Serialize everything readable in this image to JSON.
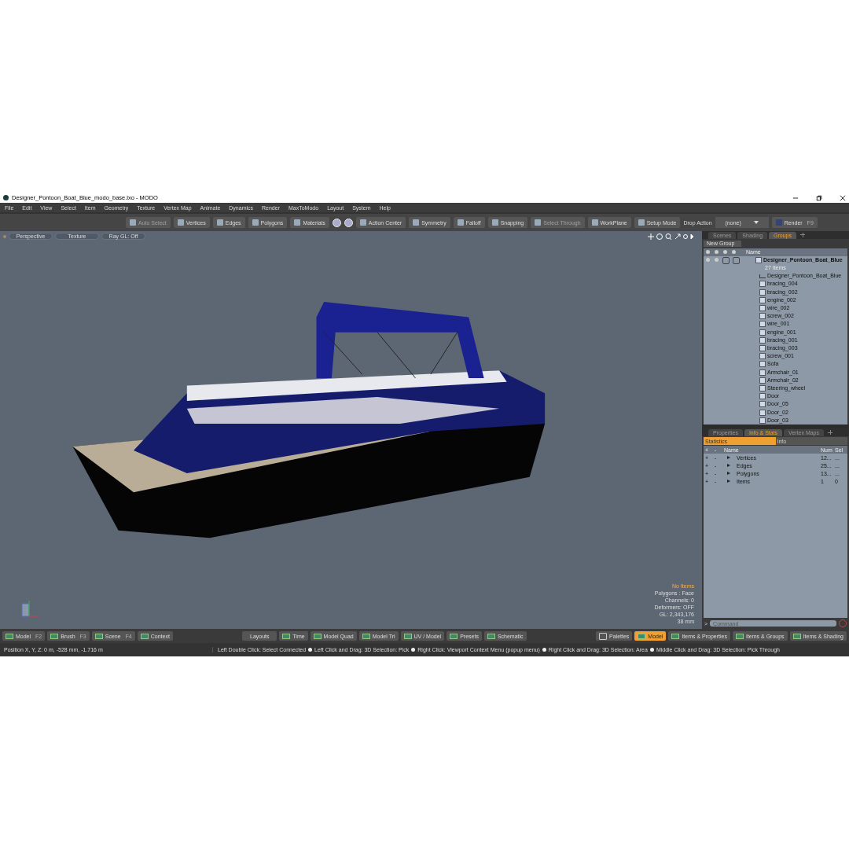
{
  "window": {
    "title": "Designer_Pontoon_Boat_Blue_modo_base.lxo - MODO"
  },
  "menu": [
    "File",
    "Edit",
    "View",
    "Select",
    "Item",
    "Geometry",
    "Texture",
    "Vertex Map",
    "Animate",
    "Dynamics",
    "Render",
    "MaxToModo",
    "Layout",
    "System",
    "Help"
  ],
  "toolbar": [
    {
      "label": "Auto Select",
      "disabled": true
    },
    {
      "label": "Vertices",
      "disabled": false
    },
    {
      "label": "Edges",
      "disabled": false
    },
    {
      "label": "Polygons",
      "disabled": false
    },
    {
      "label": "Materials",
      "disabled": false
    },
    {
      "label": "Action Center",
      "disabled": false
    },
    {
      "label": "Symmetry",
      "disabled": false
    },
    {
      "label": "Falloff",
      "disabled": false
    },
    {
      "label": "Snapping",
      "disabled": false
    },
    {
      "label": "Select Through",
      "disabled": true
    },
    {
      "label": "WorkPlane",
      "disabled": false
    },
    {
      "label": "Setup Mode",
      "disabled": false
    }
  ],
  "drop_action": {
    "label": "Drop Action",
    "value": "(none)"
  },
  "render": {
    "label": "Render",
    "shortcut": "F9"
  },
  "viewport": {
    "tabs": [
      "Perspective",
      "Texture",
      "Ray GL: Off"
    ],
    "info": [
      {
        "text": "No Items",
        "highlight": true
      },
      {
        "text": "Polygons : Face",
        "highlight": false
      },
      {
        "text": "Channels: 0",
        "highlight": false
      },
      {
        "text": "Deformers: OFF",
        "highlight": false
      },
      {
        "text": "GL: 2,343,176",
        "highlight": false
      },
      {
        "text": "38 mm",
        "highlight": false
      }
    ]
  },
  "groups_panel": {
    "tabs": [
      {
        "label": "Scenes",
        "selected": false
      },
      {
        "label": "Shading",
        "selected": false
      },
      {
        "label": "Groups",
        "selected": true
      }
    ],
    "new_group": "New Group",
    "column": "Name",
    "root": {
      "name": "Designer_Pontoon_Boat_Blue",
      "count": "27 Items",
      "toggles": [
        {
          "checked": false
        },
        {
          "checked": false
        }
      ]
    },
    "items": [
      {
        "name": "Designer_Pontoon_Boat_Blue",
        "kind": "locator"
      },
      {
        "name": "bracing_004",
        "kind": "mesh"
      },
      {
        "name": "bracing_002",
        "kind": "mesh"
      },
      {
        "name": "engine_002",
        "kind": "mesh"
      },
      {
        "name": "wire_002",
        "kind": "mesh"
      },
      {
        "name": "screw_002",
        "kind": "mesh"
      },
      {
        "name": "wire_001",
        "kind": "mesh"
      },
      {
        "name": "engine_001",
        "kind": "mesh"
      },
      {
        "name": "bracing_001",
        "kind": "mesh"
      },
      {
        "name": "bracing_003",
        "kind": "mesh"
      },
      {
        "name": "screw_001",
        "kind": "mesh"
      },
      {
        "name": "Sofa",
        "kind": "mesh"
      },
      {
        "name": "Armchair_01",
        "kind": "mesh"
      },
      {
        "name": "Armchair_02",
        "kind": "mesh"
      },
      {
        "name": "Steering_wheel",
        "kind": "mesh"
      },
      {
        "name": "Door",
        "kind": "mesh"
      },
      {
        "name": "Door_05",
        "kind": "mesh"
      },
      {
        "name": "Door_02",
        "kind": "mesh"
      },
      {
        "name": "Door_03",
        "kind": "mesh"
      }
    ]
  },
  "stats_panel": {
    "tabs": [
      {
        "label": "Properties",
        "selected": false
      },
      {
        "label": "Info & Stats",
        "selected": true
      },
      {
        "label": "Vertex Maps",
        "selected": false
      }
    ],
    "subtabs": [
      {
        "label": "Statistics",
        "selected": true
      },
      {
        "label": "Info",
        "selected": false
      }
    ],
    "columns": [
      "+",
      "-",
      "Name",
      "Num",
      "Sel"
    ],
    "rows": [
      {
        "plus": "+",
        "minus": "-",
        "name": "Vertices",
        "num": "12...",
        "sel": "..."
      },
      {
        "plus": "+",
        "minus": "-",
        "name": "Edges",
        "num": "25...",
        "sel": "..."
      },
      {
        "plus": "+",
        "minus": "-",
        "name": "Polygons",
        "num": "13...",
        "sel": "..."
      },
      {
        "plus": "+",
        "minus": "-",
        "name": "Items",
        "num": "1",
        "sel": "0"
      }
    ],
    "command_prompt": ">",
    "command_placeholder": "Command"
  },
  "bottom_left": [
    {
      "label": "Model",
      "shortcut": "F2"
    },
    {
      "label": "Brush",
      "shortcut": "F3"
    },
    {
      "label": "Scene",
      "shortcut": "F4"
    },
    {
      "label": "Context"
    }
  ],
  "bottom_center": [
    {
      "label": "Layouts",
      "kind": "plain"
    },
    {
      "label": "Time",
      "kind": "layout"
    },
    {
      "label": "Model Quad",
      "kind": "layout"
    },
    {
      "label": "Model Tri",
      "kind": "layout"
    },
    {
      "label": "UV / Model",
      "kind": "layout"
    },
    {
      "label": "Presets",
      "kind": "layout"
    },
    {
      "label": "Schematic",
      "kind": "layout"
    }
  ],
  "bottom_right": [
    {
      "label": "Palettes",
      "kind": "palettes",
      "selected": false
    },
    {
      "label": "Model",
      "kind": "layout",
      "selected": true
    },
    {
      "label": "Items & Properties",
      "kind": "layout",
      "selected": false
    },
    {
      "label": "Items & Groups",
      "kind": "layout",
      "selected": false
    },
    {
      "label": "Items & Shading",
      "kind": "layout",
      "selected": false
    }
  ],
  "status": {
    "position": "Position X, Y, Z:   0 m, -528 mm, -1.716 m",
    "hints": [
      "Left Double Click: Select Connected",
      "Left Click and Drag: 3D Selection: Pick",
      "Right Click: Viewport Context Menu (popup menu)",
      "Right Click and Drag: 3D Selection: Area",
      "Middle Click and Drag: 3D Selection: Pick Through"
    ]
  }
}
